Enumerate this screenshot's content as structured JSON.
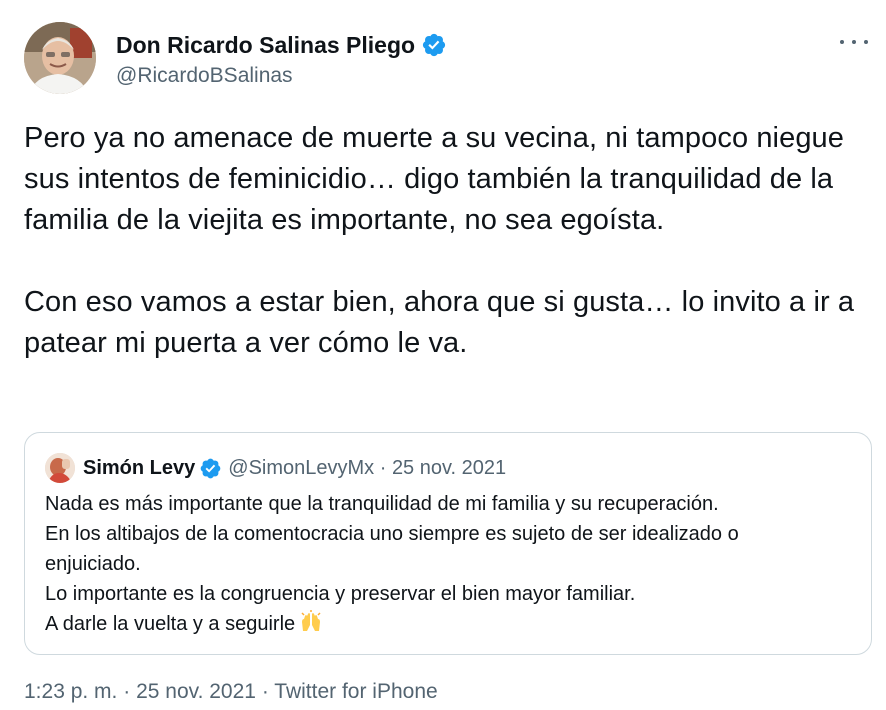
{
  "author": {
    "display_name": "Don Ricardo Salinas Pliego",
    "handle": "@RicardoBSalinas",
    "verified_icon": "verified-badge-icon",
    "avatar_icon": "user-avatar"
  },
  "more_icon": "more-options-icon",
  "tweet": {
    "paragraph_1": "Pero ya no amenace de muerte a su vecina, ni tampoco niegue sus intentos de feminicidio… digo también la tranquilidad de la familia de la viejita es importante, no sea egoísta.",
    "paragraph_2": "Con eso vamos a estar bien, ahora que si gusta… lo invito a ir a patear mi puerta a ver cómo le va."
  },
  "quote": {
    "display_name": "Simón Levy",
    "meta": "@SimonLevyMx · 25 nov. 2021",
    "lines": [
      "Nada es más importante que la tranquilidad de mi familia y su recuperación.",
      "En los altibajos de la comentocracia uno siempre es sujeto de ser idealizado o",
      "enjuiciado.",
      "Lo importante es la congruencia y preservar el bien mayor familiar.",
      "A darle la vuelta y a seguirle"
    ],
    "emoji_icon": "raising-hands-emoji-icon"
  },
  "footer": {
    "time": "1:23 p. m.",
    "separator": "·",
    "date": "25 nov. 2021",
    "source": "Twitter for iPhone"
  },
  "colors": {
    "text_primary": "#0f1419",
    "text_secondary": "#536471",
    "verified_blue": "#1d9bf0",
    "border": "#cfd9de"
  }
}
